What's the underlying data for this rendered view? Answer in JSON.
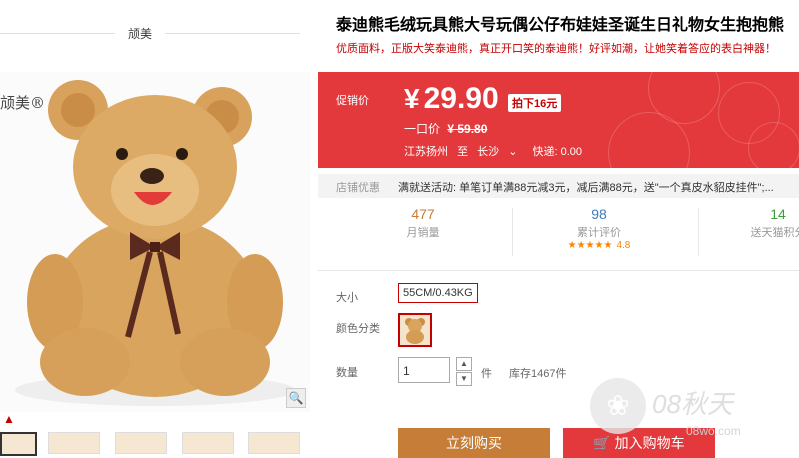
{
  "shop": {
    "name": "颃美"
  },
  "image": {
    "brand_text": "颃美®",
    "zoom_icon": "magnifier-icon"
  },
  "product": {
    "title": "泰迪熊毛绒玩具熊大号玩偶公仔布娃娃圣诞生日礼物女生抱抱熊",
    "subtitle": "优质面料，正版大笑泰迪熊，真正开口笑的泰迪熊！好评如潮，让她笑着答应的表白神器！"
  },
  "pricing": {
    "promo_label": "促销价",
    "currency": "¥",
    "price": "29.90",
    "discount_badge": "拍下16元",
    "original_label": "一口价",
    "original_price": "¥ 59.80",
    "from": "江苏扬州",
    "to_word": "至",
    "destination": "长沙",
    "shipping": "快递: 0.00"
  },
  "promotion": {
    "label": "店铺优惠",
    "text": "满就送活动: 单笔订单满88元减3元，减后满88元，送\"一个真皮水貂皮挂件\";..."
  },
  "stats": [
    {
      "num": "477",
      "label": "月销量"
    },
    {
      "num": "98",
      "label": "累计评价",
      "stars": "★★★★★",
      "rating": "4.8"
    },
    {
      "num": "14",
      "label": "送天猫积分"
    }
  ],
  "options": {
    "size_label": "大小",
    "size_value": "55CM/0.43KG",
    "color_label": "颜色分类",
    "qty_label": "数量",
    "qty_value": "1",
    "unit": "件",
    "stock": "库存1467件"
  },
  "actions": {
    "buy_now": "立刻购买",
    "add_cart": "加入购物车"
  },
  "watermark": {
    "text": "08秋天",
    "sub": "08wo.com"
  },
  "colors": {
    "accent": "#e4393c",
    "buy": "#c57d38"
  }
}
